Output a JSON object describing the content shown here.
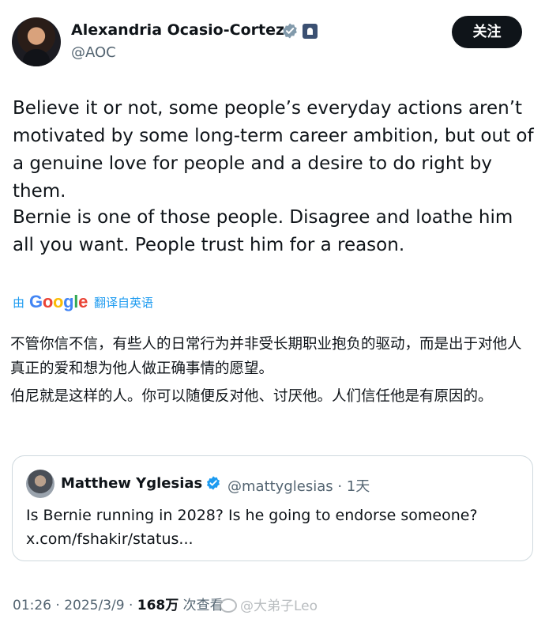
{
  "author": {
    "name": "Alexandria Ocasio-Cortez",
    "handle": "@AOC",
    "verified": true,
    "government_badge": true
  },
  "follow_button": {
    "label": "关注"
  },
  "tweet": {
    "paragraphs": [
      "Believe it or not, some people’s everyday actions aren’t motivated by some long-term career ambition, but out of a genuine love for people and a desire to do right by them.",
      "Bernie is one of those people. Disagree and loathe him all you want. People trust him for a reason."
    ]
  },
  "translation": {
    "prefix": "由",
    "provider": "Google",
    "label": "翻译自英语",
    "paragraphs": [
      "不管你信不信，有些人的日常行为并非受长期职业抱负的驱动，而是出于对他人真正的爱和想为他人做正确事情的愿望。",
      "伯尼就是这样的人。你可以随便反对他、讨厌他。人们信任他是有原因的。"
    ]
  },
  "quoted_tweet": {
    "name": "Matthew Yglesias",
    "handle_and_time": "@mattyglesias · 1天",
    "text": "Is Bernie running in 2028? Is he going to endorse someone?",
    "link": "x.com/fshakir/status..."
  },
  "meta": {
    "time_date": "01:26 · 2025/3/9 · ",
    "views": "168万",
    "views_label": " 次查看"
  },
  "watermark": {
    "text": "@大弟子Leo"
  },
  "colors": {
    "accent": "#1d9bf0",
    "text": "#0f1419",
    "secondary": "#536471",
    "border": "#cfd9de"
  }
}
